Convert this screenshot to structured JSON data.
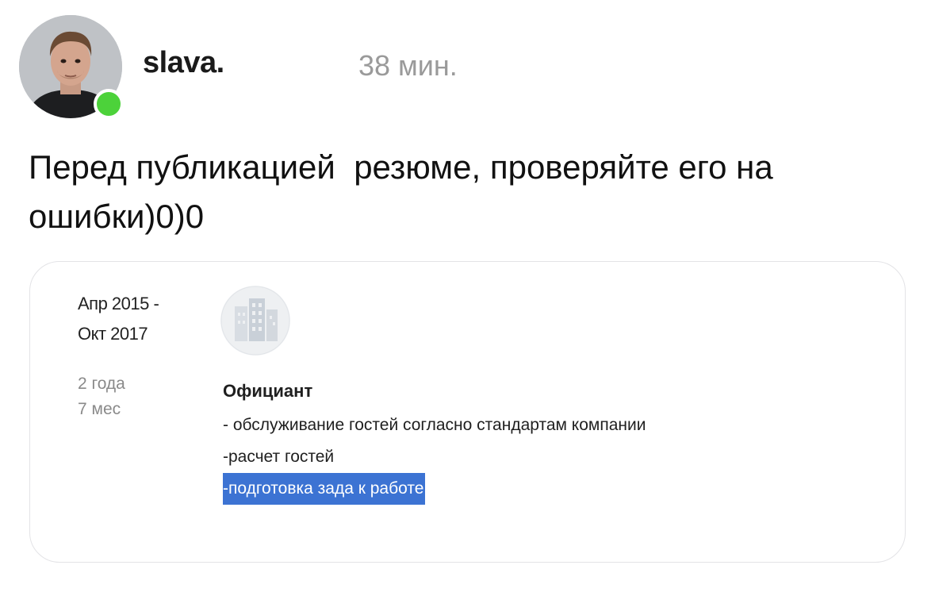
{
  "post": {
    "author": "slava.",
    "time": "38 мин.",
    "text": "Перед публикацией  резюме, проверяйте его на\nошибки)0)0",
    "online_color": "#4cd23a"
  },
  "resume": {
    "date_start": "Апр 2015 -",
    "date_end": "Окт 2017",
    "duration_years": "2 года",
    "duration_months": "7 мес",
    "company_logo_icon": "building-icon",
    "job_title": "Официант",
    "duties": [
      "- обслуживание гостей согласно стандартам компании",
      "-расчет гостей",
      "-подготовка зада к работе"
    ],
    "highlight_color": "#3c73d3"
  }
}
